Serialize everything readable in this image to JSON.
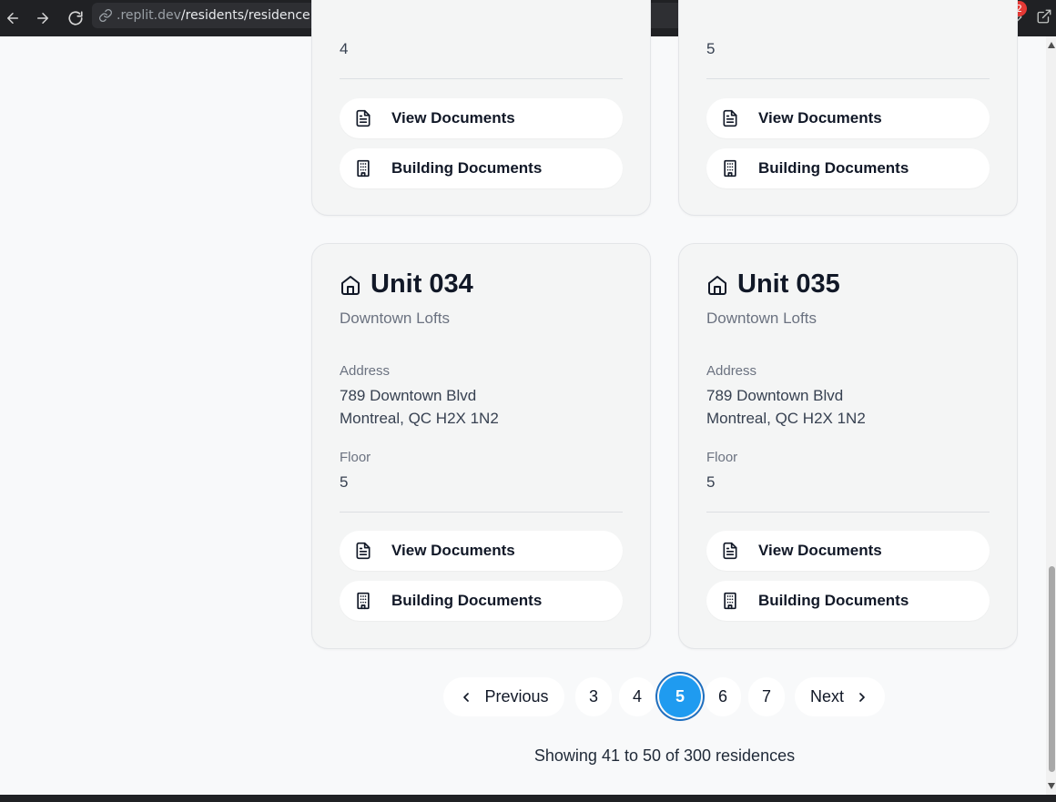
{
  "browser": {
    "url_host": ".replit.dev",
    "url_path": "/residents/residence",
    "notification_count": "2"
  },
  "top_cards": [
    {
      "floor_value": "4",
      "view_documents_label": "View Documents",
      "building_documents_label": "Building Documents"
    },
    {
      "floor_value": "5",
      "view_documents_label": "View Documents",
      "building_documents_label": "Building Documents"
    }
  ],
  "cards": [
    {
      "unit": "Unit 034",
      "building": "Downtown Lofts",
      "address_label": "Address",
      "address_line1": "789 Downtown Blvd",
      "address_line2": "Montreal, QC H2X 1N2",
      "floor_label": "Floor",
      "floor_value": "5",
      "view_documents_label": "View Documents",
      "building_documents_label": "Building Documents"
    },
    {
      "unit": "Unit 035",
      "building": "Downtown Lofts",
      "address_label": "Address",
      "address_line1": "789 Downtown Blvd",
      "address_line2": "Montreal, QC H2X 1N2",
      "floor_label": "Floor",
      "floor_value": "5",
      "view_documents_label": "View Documents",
      "building_documents_label": "Building Documents"
    }
  ],
  "pagination": {
    "previous_label": "Previous",
    "next_label": "Next",
    "pages": [
      "3",
      "4",
      "5",
      "6",
      "7"
    ],
    "current_page": "5",
    "summary": "Showing 41 to 50 of 300 residences"
  },
  "colors": {
    "active_page": "#1f9bf0",
    "background": "#f8f9fa",
    "card": "#f4f5f5"
  }
}
